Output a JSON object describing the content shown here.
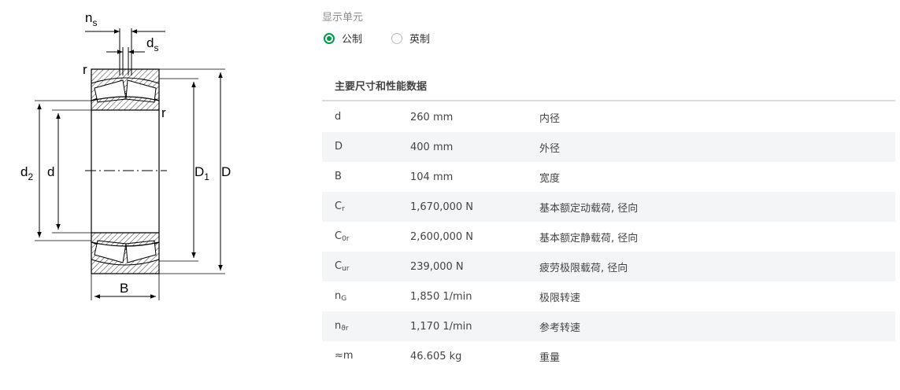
{
  "display_unit": {
    "label": "显示单元",
    "options": [
      {
        "label": "公制",
        "checked": true
      },
      {
        "label": "英制",
        "checked": false
      }
    ]
  },
  "table": {
    "title": "主要尺寸和性能数据",
    "rows": [
      {
        "symbol": "d",
        "sub": "",
        "value": "260 mm",
        "desc": "内径"
      },
      {
        "symbol": "D",
        "sub": "",
        "value": "400 mm",
        "desc": "外径"
      },
      {
        "symbol": "B",
        "sub": "",
        "value": "104 mm",
        "desc": "宽度"
      },
      {
        "symbol": "C",
        "sub": "r",
        "value": "1,670,000 N",
        "desc": "基本额定动载荷, 径向"
      },
      {
        "symbol": "C",
        "sub": "0r",
        "value": "2,600,000 N",
        "desc": "基本额定静载荷, 径向"
      },
      {
        "symbol": "C",
        "sub": "ur",
        "value": "239,000 N",
        "desc": "疲劳极限载荷, 径向"
      },
      {
        "symbol": "n",
        "sub": "G",
        "value": "1,850 1/min",
        "desc": "极限转速"
      },
      {
        "symbol": "n",
        "sub": "ϑr",
        "value": "1,170 1/min",
        "desc": "参考转速"
      },
      {
        "symbol": "≈m",
        "sub": "",
        "value": "46.605 kg",
        "desc": "重量"
      }
    ]
  },
  "drawing": {
    "labels": {
      "ns": "n",
      "ns_sub": "s",
      "ds": "d",
      "ds_sub": "s",
      "r_top": "r",
      "r_mid": "r",
      "d2": "d",
      "d2_sub": "2",
      "d": "d",
      "D1": "D",
      "D1_sub": "1",
      "D": "D",
      "B": "B"
    }
  }
}
